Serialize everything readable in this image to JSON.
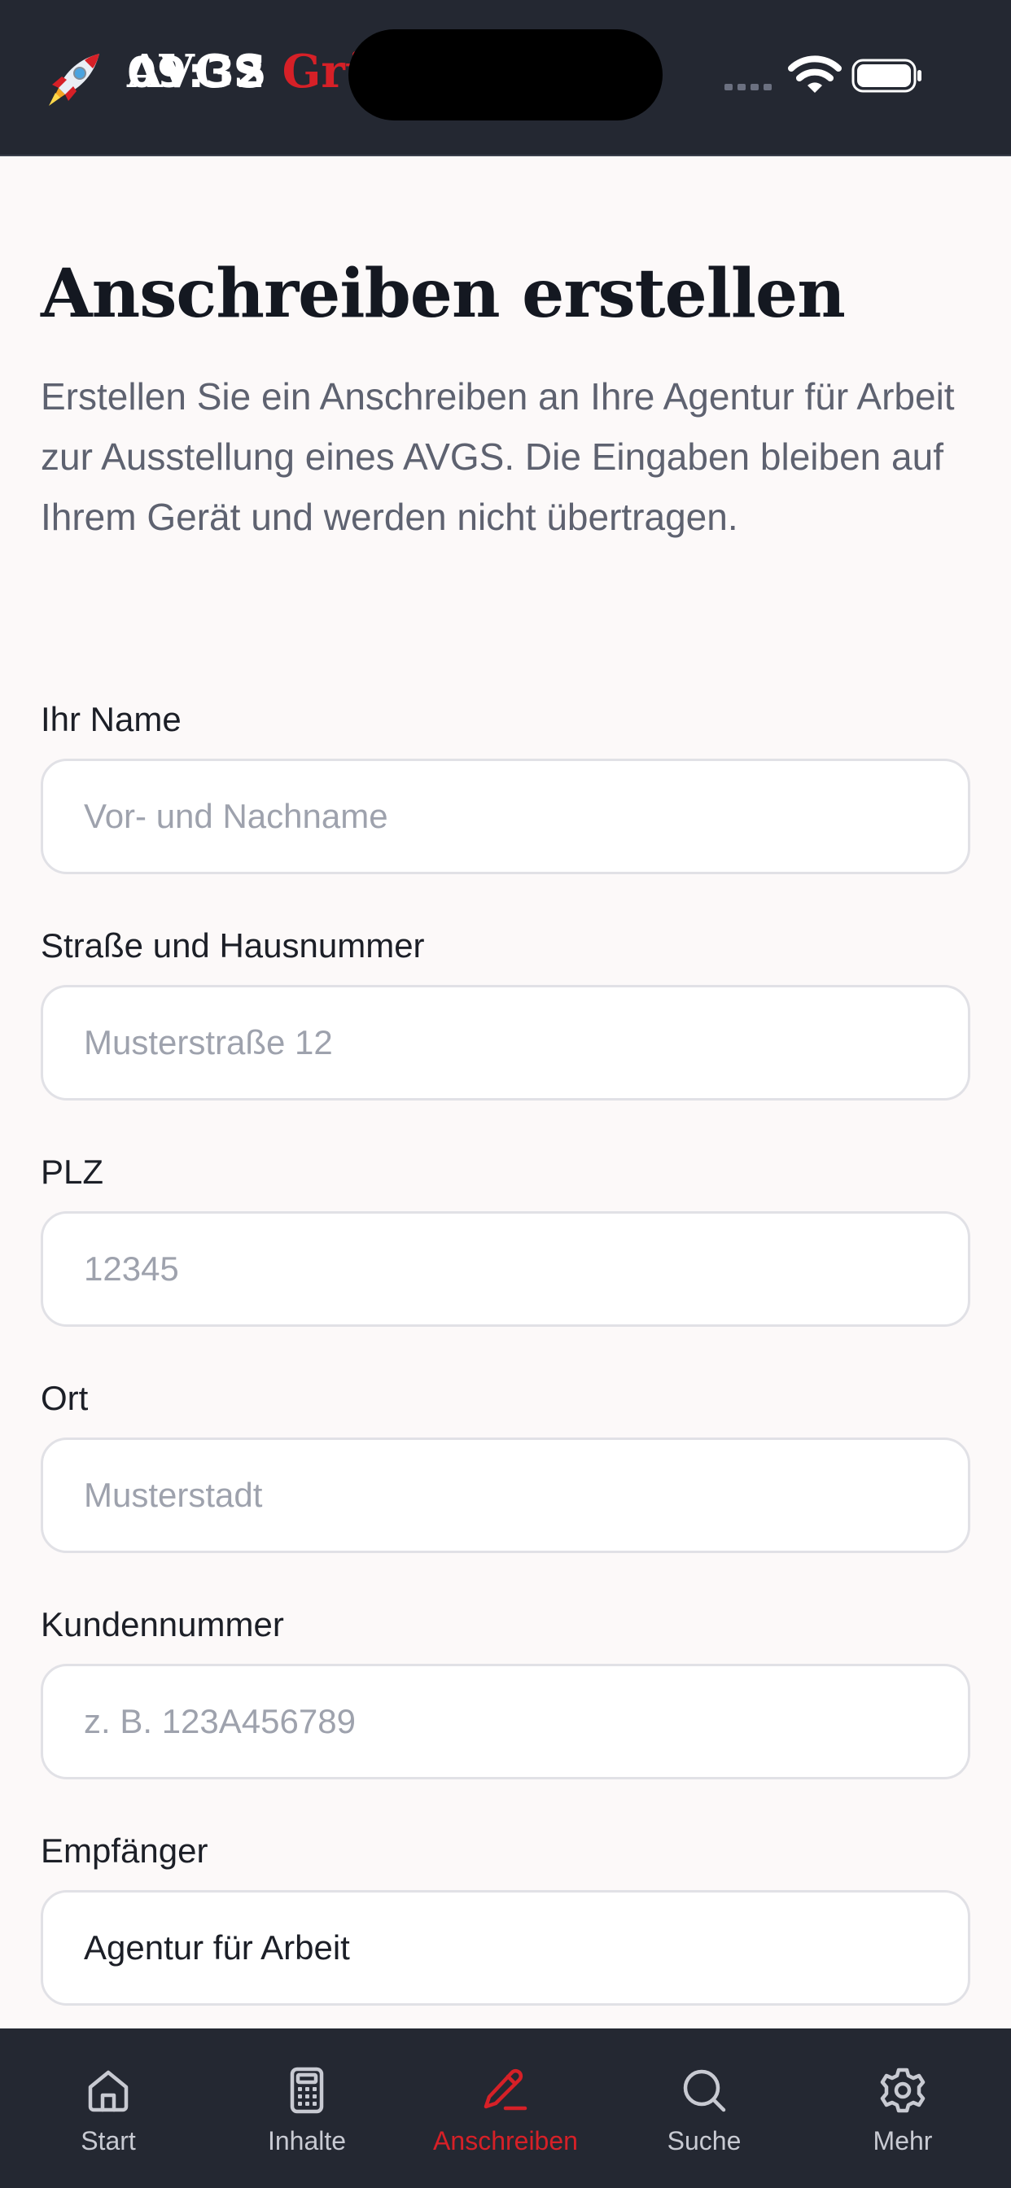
{
  "status_bar": {
    "time": "09:32"
  },
  "header": {
    "brand_part1": "AVGS",
    "brand_part2": "Grü",
    "brand_colors": {
      "text": "#ffffff",
      "accent": "#d62027"
    },
    "logo_icon": "rocket-icon"
  },
  "page": {
    "title": "Anschreiben erstellen",
    "intro": "Erstellen Sie ein Anschreiben an Ihre Agentur für Arbeit zur Ausstellung eines AVGS. Die Eingaben bleiben auf Ihrem Gerät und werden nicht übertragen."
  },
  "form": {
    "name": {
      "label": "Ihr Name",
      "placeholder": "Vor- und Nachname",
      "value": ""
    },
    "street": {
      "label": "Straße und Hausnummer",
      "placeholder": "Musterstraße 12",
      "value": ""
    },
    "zip": {
      "label": "PLZ",
      "placeholder": "12345",
      "value": ""
    },
    "city": {
      "label": "Ort",
      "placeholder": "Musterstadt",
      "value": ""
    },
    "customer_number": {
      "label": "Kundennummer",
      "placeholder": "z. B. 123A456789",
      "value": ""
    },
    "recipient": {
      "label": "Empfänger",
      "placeholder": "",
      "value": "Agentur für Arbeit"
    }
  },
  "tabbar": {
    "active_color": "#d62027",
    "items": [
      {
        "label": "Start",
        "icon": "home-icon"
      },
      {
        "label": "Inhalte",
        "icon": "calculator-icon"
      },
      {
        "label": "Anschreiben",
        "icon": "pen-icon",
        "active": true
      },
      {
        "label": "Suche",
        "icon": "search-icon"
      },
      {
        "label": "Mehr",
        "icon": "gear-icon"
      }
    ]
  }
}
